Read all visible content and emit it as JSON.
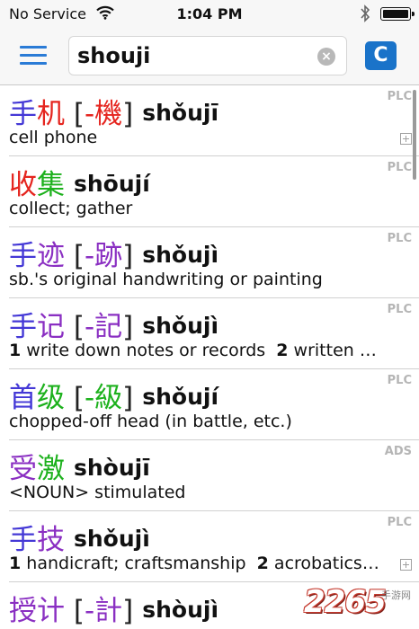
{
  "status": {
    "carrier": "No Service",
    "time": "1:04 PM"
  },
  "toolbar": {
    "search_value": "shouji",
    "clear_glyph": "×",
    "c_button_label": "C"
  },
  "entries": [
    {
      "chars": [
        {
          "t": "手",
          "c": "t3"
        },
        {
          "t": "机",
          "c": "t1"
        }
      ],
      "trad": [
        {
          "t": "-",
          "c": "t1"
        },
        {
          "t": "機",
          "c": "t1"
        }
      ],
      "pinyin": "shǒujī",
      "def": "cell phone",
      "def_parts": [],
      "src": "PLC",
      "plus": true
    },
    {
      "chars": [
        {
          "t": "收",
          "c": "t1"
        },
        {
          "t": "集",
          "c": "t2"
        }
      ],
      "trad": [],
      "pinyin": "shōují",
      "def": "collect; gather",
      "def_parts": [],
      "src": "PLC",
      "plus": false
    },
    {
      "chars": [
        {
          "t": "手",
          "c": "t3"
        },
        {
          "t": "迹",
          "c": "t4"
        }
      ],
      "trad": [
        {
          "t": "-",
          "c": "t4"
        },
        {
          "t": "跡",
          "c": "t4"
        }
      ],
      "pinyin": "shǒujì",
      "def": "sb.'s original handwriting or painting",
      "def_parts": [],
      "src": "PLC",
      "plus": false
    },
    {
      "chars": [
        {
          "t": "手",
          "c": "t3"
        },
        {
          "t": "记",
          "c": "t4"
        }
      ],
      "trad": [
        {
          "t": "-",
          "c": "t4"
        },
        {
          "t": "記",
          "c": "t4"
        }
      ],
      "pinyin": "shǒujì",
      "def": "",
      "def_parts": [
        {
          "num": "1",
          "text": " write down notes or records  "
        },
        {
          "num": "2",
          "text": " written …"
        }
      ],
      "src": "PLC",
      "plus": false
    },
    {
      "chars": [
        {
          "t": "首",
          "c": "t3"
        },
        {
          "t": "级",
          "c": "t2"
        }
      ],
      "trad": [
        {
          "t": "-",
          "c": "t2"
        },
        {
          "t": "級",
          "c": "t2"
        }
      ],
      "pinyin": "shǒují",
      "def": "chopped-off head (in battle, etc.)",
      "def_parts": [],
      "src": "PLC",
      "plus": false
    },
    {
      "chars": [
        {
          "t": "受",
          "c": "t4"
        },
        {
          "t": "激",
          "c": "t2"
        }
      ],
      "trad": [],
      "pinyin": "shòujī",
      "def": "<NOUN> stimulated",
      "def_parts": [],
      "src": "ADS",
      "plus": false
    },
    {
      "chars": [
        {
          "t": "手",
          "c": "t3"
        },
        {
          "t": "技",
          "c": "t4"
        }
      ],
      "trad": [],
      "pinyin": "shǒujì",
      "def": "",
      "def_parts": [
        {
          "num": "1",
          "text": " handicraft; craftsmanship  "
        },
        {
          "num": "2",
          "text": " acrobatics…"
        }
      ],
      "src": "PLC",
      "plus": true
    },
    {
      "chars": [
        {
          "t": "授",
          "c": "t4"
        },
        {
          "t": "计",
          "c": "t4"
        }
      ],
      "trad": [
        {
          "t": "-",
          "c": "t4"
        },
        {
          "t": "計",
          "c": "t4"
        }
      ],
      "pinyin": "shòujì",
      "def": "",
      "def_parts": [],
      "src": "",
      "plus": false
    }
  ],
  "watermark": {
    "logo": "2265",
    "sub": "手游网"
  }
}
